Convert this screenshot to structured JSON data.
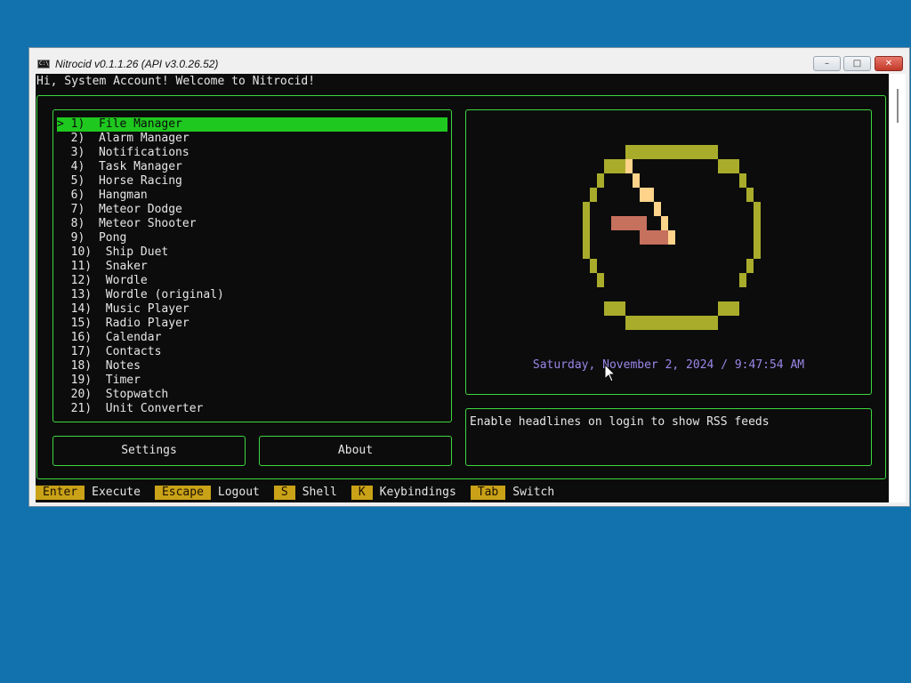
{
  "window": {
    "title": "Nitrocid v0.1.1.26 (API v3.0.26.52)",
    "icon": "console-icon",
    "controls": {
      "minimize": "minimize-icon",
      "maximize": "maximize-icon",
      "close": "close-icon"
    }
  },
  "greeting": "Hi, System Account! Welcome to Nitrocid!",
  "menu": {
    "selected_index": 0,
    "items": [
      {
        "number": "> 1)",
        "label": "File Manager"
      },
      {
        "number": "  2)",
        "label": "Alarm Manager"
      },
      {
        "number": "  3)",
        "label": "Notifications"
      },
      {
        "number": "  4)",
        "label": "Task Manager"
      },
      {
        "number": "  5)",
        "label": "Horse Racing"
      },
      {
        "number": "  6)",
        "label": "Hangman"
      },
      {
        "number": "  7)",
        "label": "Meteor Dodge"
      },
      {
        "number": "  8)",
        "label": "Meteor Shooter"
      },
      {
        "number": "  9)",
        "label": "Pong"
      },
      {
        "number": "  10)",
        "label": "Ship Duet"
      },
      {
        "number": "  11)",
        "label": "Snaker"
      },
      {
        "number": "  12)",
        "label": "Wordle"
      },
      {
        "number": "  13)",
        "label": "Wordle (original)"
      },
      {
        "number": "  14)",
        "label": "Music Player"
      },
      {
        "number": "  15)",
        "label": "Radio Player"
      },
      {
        "number": "  16)",
        "label": "Calendar"
      },
      {
        "number": "  17)",
        "label": "Contacts"
      },
      {
        "number": "  18)",
        "label": "Notes"
      },
      {
        "number": "  19)",
        "label": "Timer"
      },
      {
        "number": "  20)",
        "label": "Stopwatch"
      },
      {
        "number": "  21)",
        "label": "Unit Converter"
      }
    ]
  },
  "buttons": {
    "settings": "Settings",
    "about": "About"
  },
  "clock": {
    "datetime": "Saturday, November 2, 2024 / 9:47:54 AM",
    "colors": {
      "face": "#a9ac2b",
      "hour_hand": "#c6705e",
      "minute_hand": "#ffd38a"
    }
  },
  "rss": {
    "message": "Enable headlines on login to show RSS feeds"
  },
  "statusbar": [
    {
      "key": "Enter",
      "action": "Execute"
    },
    {
      "key": "Escape",
      "action": "Logout"
    },
    {
      "key": "S",
      "action": "Shell"
    },
    {
      "key": "K",
      "action": "Keybindings"
    },
    {
      "key": "Tab",
      "action": "Switch"
    }
  ],
  "colors": {
    "desktop": "#1272ad",
    "terminal_bg": "#0c0c0c",
    "border": "#3ed83e",
    "selection": "#1fc81f",
    "key_badge": "#c9a217",
    "date_text": "#9b87e8"
  }
}
